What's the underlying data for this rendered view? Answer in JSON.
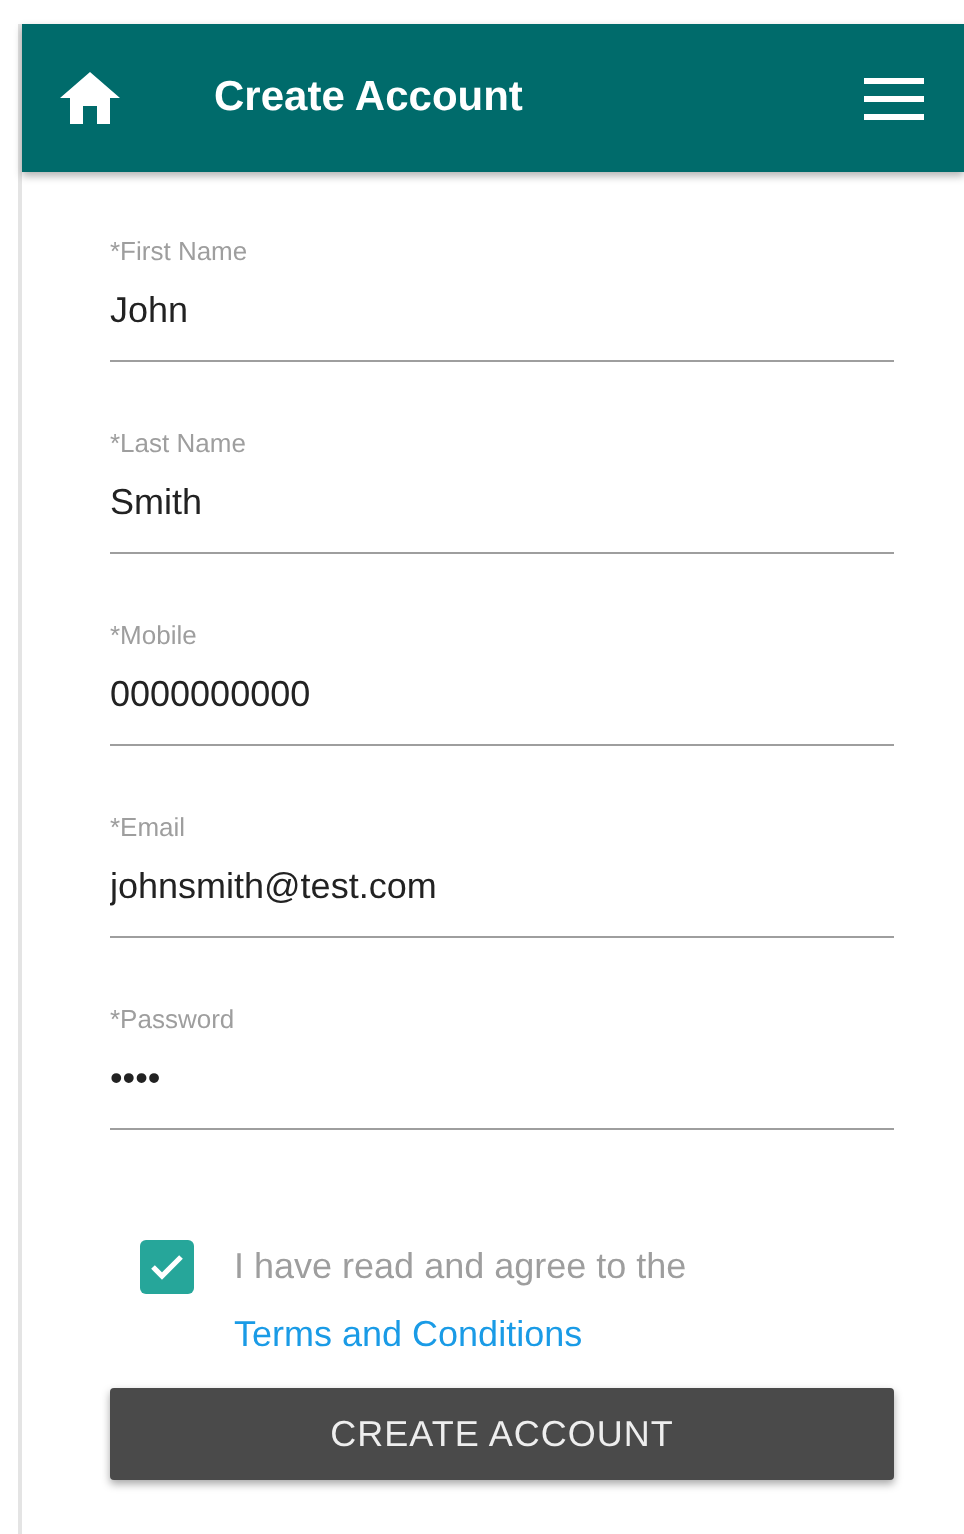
{
  "header": {
    "title": "Create Account"
  },
  "fields": [
    {
      "label": "*First Name",
      "value": "John"
    },
    {
      "label": "*Last Name",
      "value": "Smith"
    },
    {
      "label": "*Mobile",
      "value": "0000000000"
    },
    {
      "label": "*Email",
      "value": "johnsmith@test.com"
    },
    {
      "label": "*Password",
      "value": "••••"
    }
  ],
  "agreement": {
    "checked": true,
    "text": "I have read and agree to the",
    "link": "Terms and Conditions"
  },
  "submit_button": "CREATE ACCOUNT"
}
